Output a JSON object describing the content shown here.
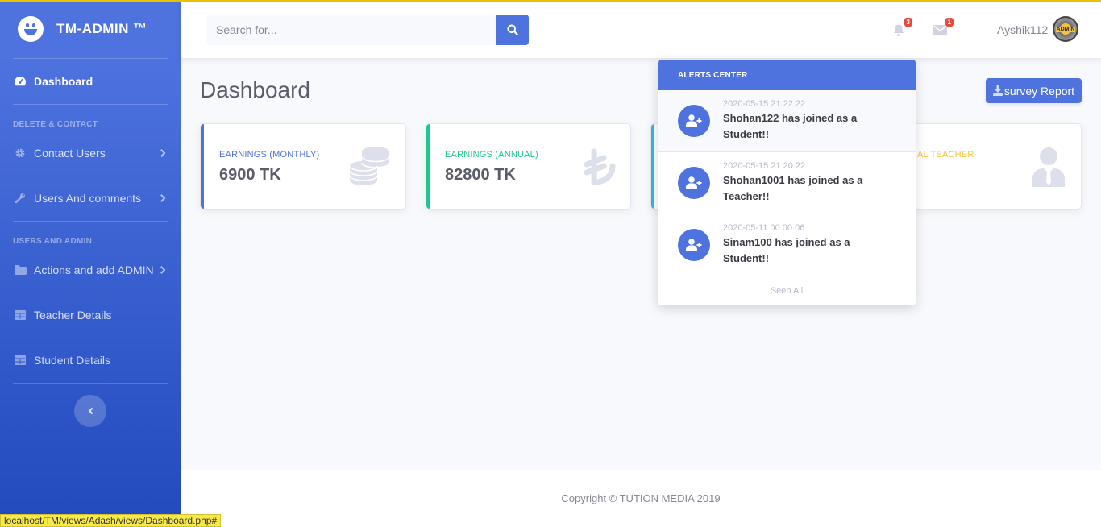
{
  "brand": {
    "name": "TM-ADMIN ™"
  },
  "sidebar": {
    "dashboard": "Dashboard",
    "heading1": "DELETE & CONTACT",
    "contact_users": "Contact Users",
    "users_comments": "Users And comments",
    "heading2": "USERS AND ADMIN",
    "actions_admin": "Actions and add ADMIN",
    "teacher_details": "Teacher Details",
    "student_details": "Student Details"
  },
  "topbar": {
    "search_placeholder": "Search for...",
    "alerts_count": "3",
    "messages_count": "1",
    "username": "Ayshik112",
    "avatar_text": "ADMIN"
  },
  "page": {
    "title": "Dashboard",
    "report_button": "survey Report"
  },
  "cards": [
    {
      "label": "EARNINGS (MONTHLY)",
      "value": "6900 TK",
      "color": "#4e73df"
    },
    {
      "label": "EARNINGS (ANNUAL)",
      "value": "82800 TK",
      "color": "#1cc88a"
    },
    {
      "label": "",
      "value": "",
      "color": "#36b9cc"
    },
    {
      "label": "AL TEACHER",
      "value": "",
      "color": "#f6c23e"
    }
  ],
  "alerts": {
    "header": "ALERTS CENTER",
    "items": [
      {
        "date": "2020-05-15 21:22:22",
        "message": "Shohan122 has joined as a Student!!"
      },
      {
        "date": "2020-05-15 21:20:22",
        "message": "Shohan1001 has joined as a Teacher!!"
      },
      {
        "date": "2020-05-11 00:00:06",
        "message": "Sinam100 has joined as a Student!!"
      }
    ],
    "footer": "Seen All"
  },
  "footer": {
    "copyright": "Copyright © TUTION MEDIA 2019"
  },
  "statusbar": {
    "url": "localhost/TM/views/Adash/views/Dashboard.php#"
  }
}
